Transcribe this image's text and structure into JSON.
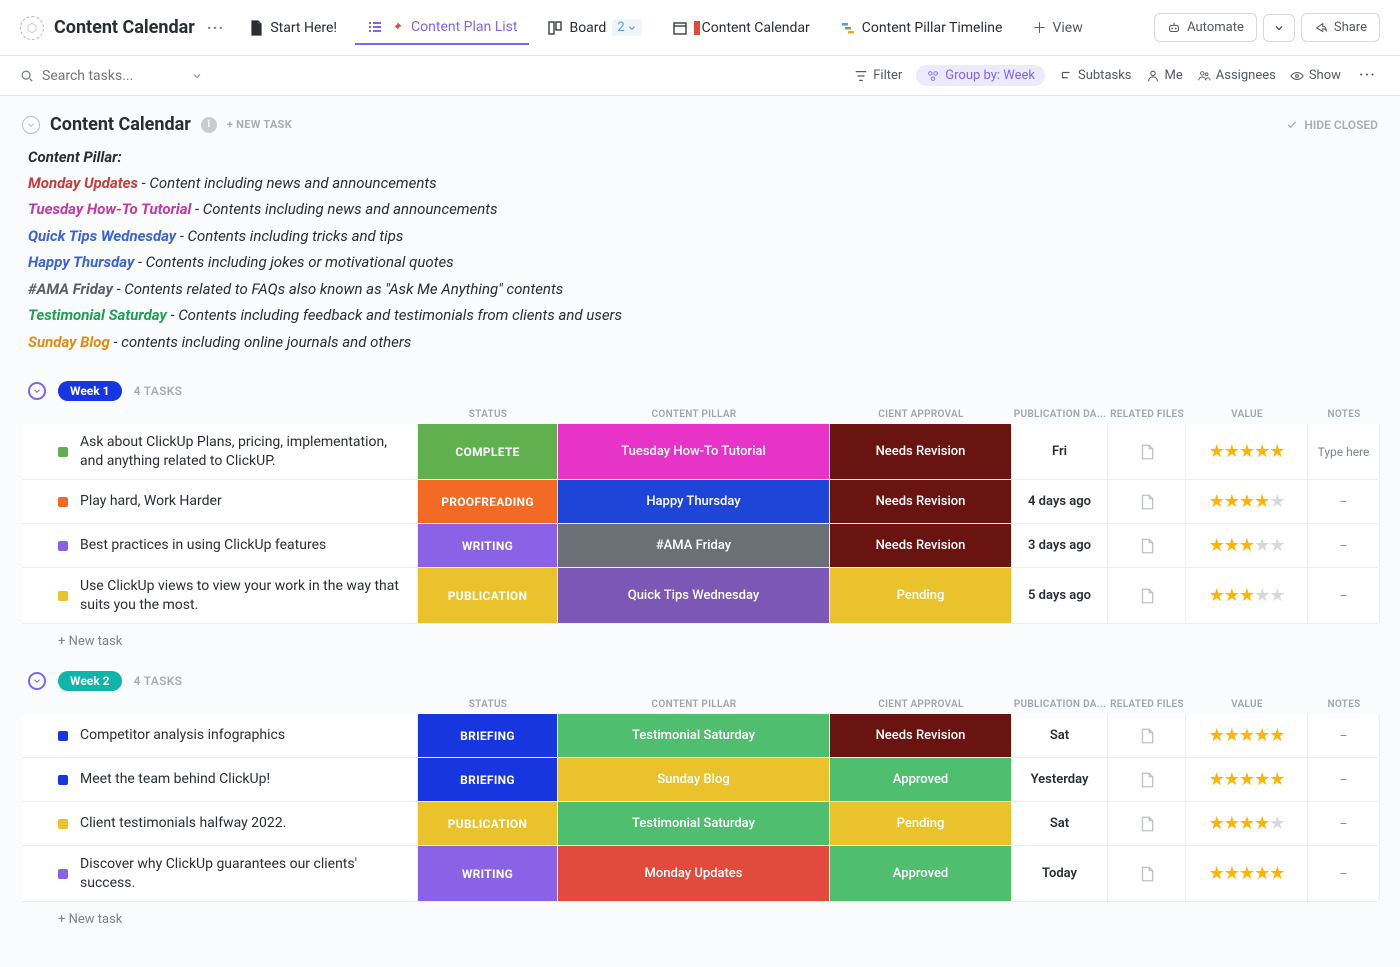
{
  "header": {
    "title": "Content Calendar",
    "views": [
      {
        "label": "Start Here!",
        "icon": "doc"
      },
      {
        "label": "Content Plan List",
        "icon": "list",
        "active": true,
        "pinned": true
      },
      {
        "label": "Board",
        "icon": "board",
        "count": "2"
      },
      {
        "label": "Content Calendar",
        "icon": "calendar"
      },
      {
        "label": "Content Pillar Timeline",
        "icon": "timeline"
      }
    ],
    "add_view": "View",
    "automate": "Automate",
    "share": "Share"
  },
  "toolbar": {
    "search_placeholder": "Search tasks...",
    "filter": "Filter",
    "group_by": "Group by: Week",
    "subtasks": "Subtasks",
    "me": "Me",
    "assignees": "Assignees",
    "show": "Show"
  },
  "section": {
    "title": "Content Calendar",
    "new_task": "+ NEW TASK",
    "hide_closed": "HIDE CLOSED"
  },
  "description": {
    "heading": "Content Pillar:",
    "pillars": [
      {
        "name": "Monday Updates",
        "color": "#c33d3d",
        "desc": "Content including news and announcements"
      },
      {
        "name": "Tuesday How-To Tutorial",
        "color": "#c13aa5",
        "desc": "Contents including news and announcements"
      },
      {
        "name": "Quick Tips Wednesday",
        "color": "#3a63d6",
        "desc": "Contents including tricks and tips"
      },
      {
        "name": "Happy Thursday",
        "color": "#3a63d6",
        "desc": "Contents including jokes or motivational quotes"
      },
      {
        "name": "#AMA Friday",
        "color": "#5c5f66",
        "desc": "Contents related to FAQs also known as \"Ask Me Anything\" contents"
      },
      {
        "name": "Testimonial Saturday",
        "color": "#1f9e52",
        "desc": "Contents including feedback and testimonials from clients and users"
      },
      {
        "name": "Sunday Blog",
        "color": "#e28c12",
        "desc": "contents including online journals and others"
      }
    ]
  },
  "columns": {
    "status": "STATUS",
    "pillar": "CONTENT PILLAR",
    "approval": "CIENT APPROVAL",
    "pubdate": "PUBLICATION DA...",
    "files": "RELATED FILES",
    "value": "VALUE",
    "notes": "NOTES"
  },
  "colors": {
    "status": {
      "COMPLETE": "#61b04f",
      "PROOFREADING": "#f36a24",
      "WRITING": "#8a62e6",
      "PUBLICATION": "#eac22c",
      "BRIEFING": "#1736e0"
    },
    "pillar": {
      "Tuesday How-To Tutorial": "#e733c7",
      "Happy Thursday": "#1f45d8",
      "#AMA Friday": "#6b7077",
      "Quick Tips Wednesday": "#7d57b5",
      "Testimonial Saturday": "#4fbf6f",
      "Sunday Blog": "#eac22c",
      "Monday Updates": "#e24b3b"
    },
    "approval": {
      "Needs Revision": "#6a1412",
      "Pending": "#eac22c",
      "Approved": "#4fbf6f"
    },
    "dot": {
      "COMPLETE": "#61b04f",
      "PROOFREADING": "#f36a24",
      "WRITING": "#8a62e6",
      "PUBLICATION": "#eac22c",
      "BRIEFING": "#1736e0"
    }
  },
  "groups": [
    {
      "label": "Week 1",
      "pill_class": "",
      "count": "4 TASKS",
      "tasks": [
        {
          "title": "Ask about ClickUp Plans, pricing, implementation, and anything related to ClickUP.",
          "status": "COMPLETE",
          "pillar": "Tuesday How-To Tutorial",
          "approval": "Needs Revision",
          "pubdate": "Fri",
          "stars": 5,
          "notes": "Type here",
          "tall": true
        },
        {
          "title": "Play hard, Work Harder",
          "status": "PROOFREADING",
          "pillar": "Happy Thursday",
          "approval": "Needs Revision",
          "pubdate": "4 days ago",
          "stars": 4,
          "notes": "–"
        },
        {
          "title": "Best practices in using ClickUp features",
          "status": "WRITING",
          "pillar": "#AMA Friday",
          "approval": "Needs Revision",
          "pubdate": "3 days ago",
          "stars": 3,
          "notes": "–"
        },
        {
          "title": "Use ClickUp views to view your work in the way that suits you the most.",
          "status": "PUBLICATION",
          "pillar": "Quick Tips Wednesday",
          "approval": "Pending",
          "pubdate": "5 days ago",
          "stars": 3,
          "notes": "–",
          "tall": true
        }
      ],
      "new_task": "+ New task"
    },
    {
      "label": "Week 2",
      "pill_class": "w2",
      "count": "4 TASKS",
      "tasks": [
        {
          "title": "Competitor analysis infographics",
          "status": "BRIEFING",
          "pillar": "Testimonial Saturday",
          "approval": "Needs Revision",
          "pubdate": "Sat",
          "stars": 5,
          "notes": "–"
        },
        {
          "title": "Meet the team behind ClickUp!",
          "status": "BRIEFING",
          "pillar": "Sunday Blog",
          "approval": "Approved",
          "pubdate": "Yesterday",
          "stars": 5,
          "notes": "–"
        },
        {
          "title": "Client testimonials halfway 2022.",
          "status": "PUBLICATION",
          "pillar": "Testimonial Saturday",
          "approval": "Pending",
          "pubdate": "Sat",
          "stars": 4,
          "notes": "–"
        },
        {
          "title": "Discover why ClickUp guarantees our clients' success.",
          "status": "WRITING",
          "pillar": "Monday Updates",
          "approval": "Approved",
          "pubdate": "Today",
          "stars": 5,
          "notes": "–",
          "tall": true
        }
      ],
      "new_task": "+ New task"
    }
  ]
}
